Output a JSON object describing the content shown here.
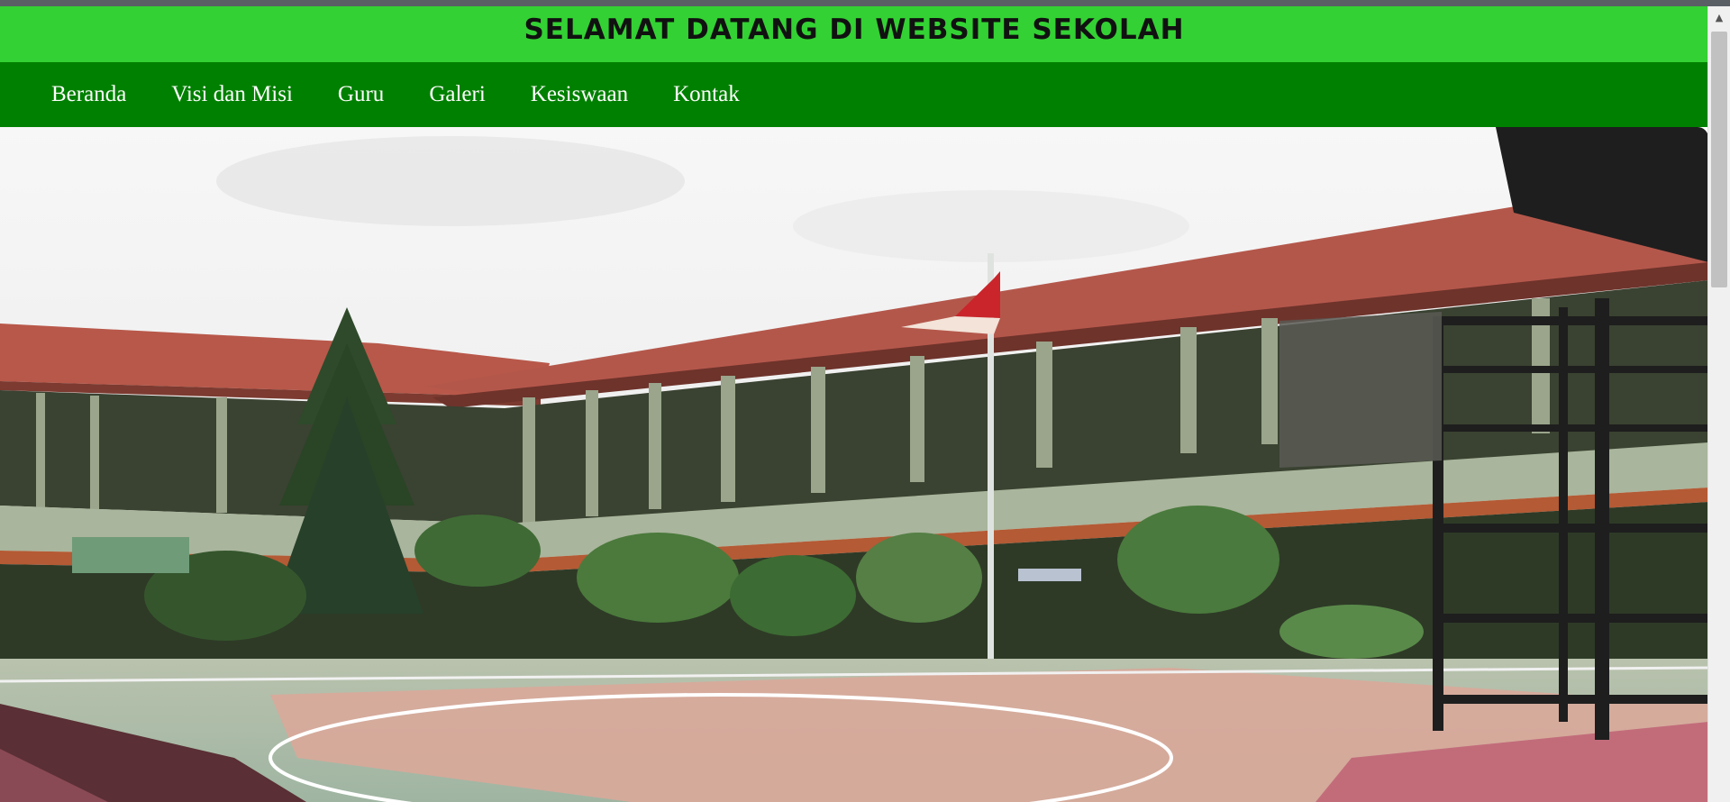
{
  "header": {
    "title": "SELAMAT DATANG DI WEBSITE SEKOLAH"
  },
  "nav": {
    "items": [
      {
        "label": "Beranda",
        "name": "nav-beranda"
      },
      {
        "label": "Visi dan Misi",
        "name": "nav-visi-dan-misi"
      },
      {
        "label": "Guru",
        "name": "nav-guru"
      },
      {
        "label": "Galeri",
        "name": "nav-galeri"
      },
      {
        "label": "Kesiswaan",
        "name": "nav-kesiswaan"
      },
      {
        "label": "Kontak",
        "name": "nav-kontak"
      }
    ]
  },
  "colors": {
    "header_bg": "#33d133",
    "nav_bg": "#008000",
    "nav_text": "#ffffff"
  },
  "scrollbar": {
    "up_icon": "chevron-up-icon"
  }
}
